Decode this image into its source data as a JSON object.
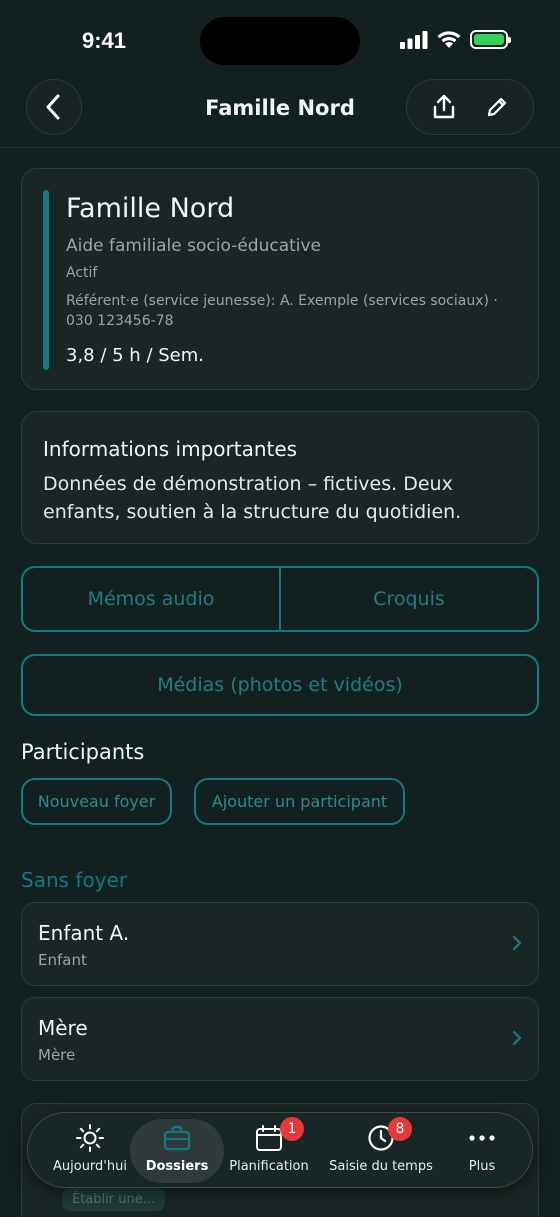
{
  "status_bar": {
    "time": "9:41"
  },
  "nav": {
    "title": "Famille Nord"
  },
  "family": {
    "title": "Famille Nord",
    "subtitle": "Aide familiale socio-éducative",
    "status": "Actif",
    "referent": "Référent·e (service jeunesse): A. Exemple (services sociaux) · 030 123456-78",
    "hours": "3,8 / 5 h / Sem."
  },
  "info": {
    "title": "Informations importantes",
    "text": "Données de démonstration – fictives. Deux enfants, soutien à la structure du quotidien."
  },
  "segments": {
    "audio": "Mémos audio",
    "sketch": "Croquis"
  },
  "media_label": "Médias (photos et vidéos)",
  "participants": {
    "title": "Participants",
    "new_household": "Nouveau foyer",
    "add_participant": "Ajouter un participant",
    "group_title": "Sans foyer",
    "items": [
      {
        "name": "Enfant A.",
        "role": "Enfant"
      },
      {
        "name": "Mère",
        "role": "Mère"
      }
    ]
  },
  "peek": {
    "tag": "Établir une..."
  },
  "tabbar": {
    "tabs": [
      {
        "label": "Aujourd'hui",
        "icon": "sun-icon"
      },
      {
        "label": "Dossiers",
        "icon": "briefcase-icon",
        "active": true
      },
      {
        "label": "Planification",
        "icon": "calendar-icon",
        "badge": "1"
      },
      {
        "label": "Saisie du temps",
        "icon": "clock-icon",
        "badge": "8"
      },
      {
        "label": "Plus",
        "icon": "more-icon"
      }
    ]
  },
  "colors": {
    "accent": "#137a80",
    "badge": "#e5383b",
    "background": "#132020",
    "battery": "#33d158"
  }
}
